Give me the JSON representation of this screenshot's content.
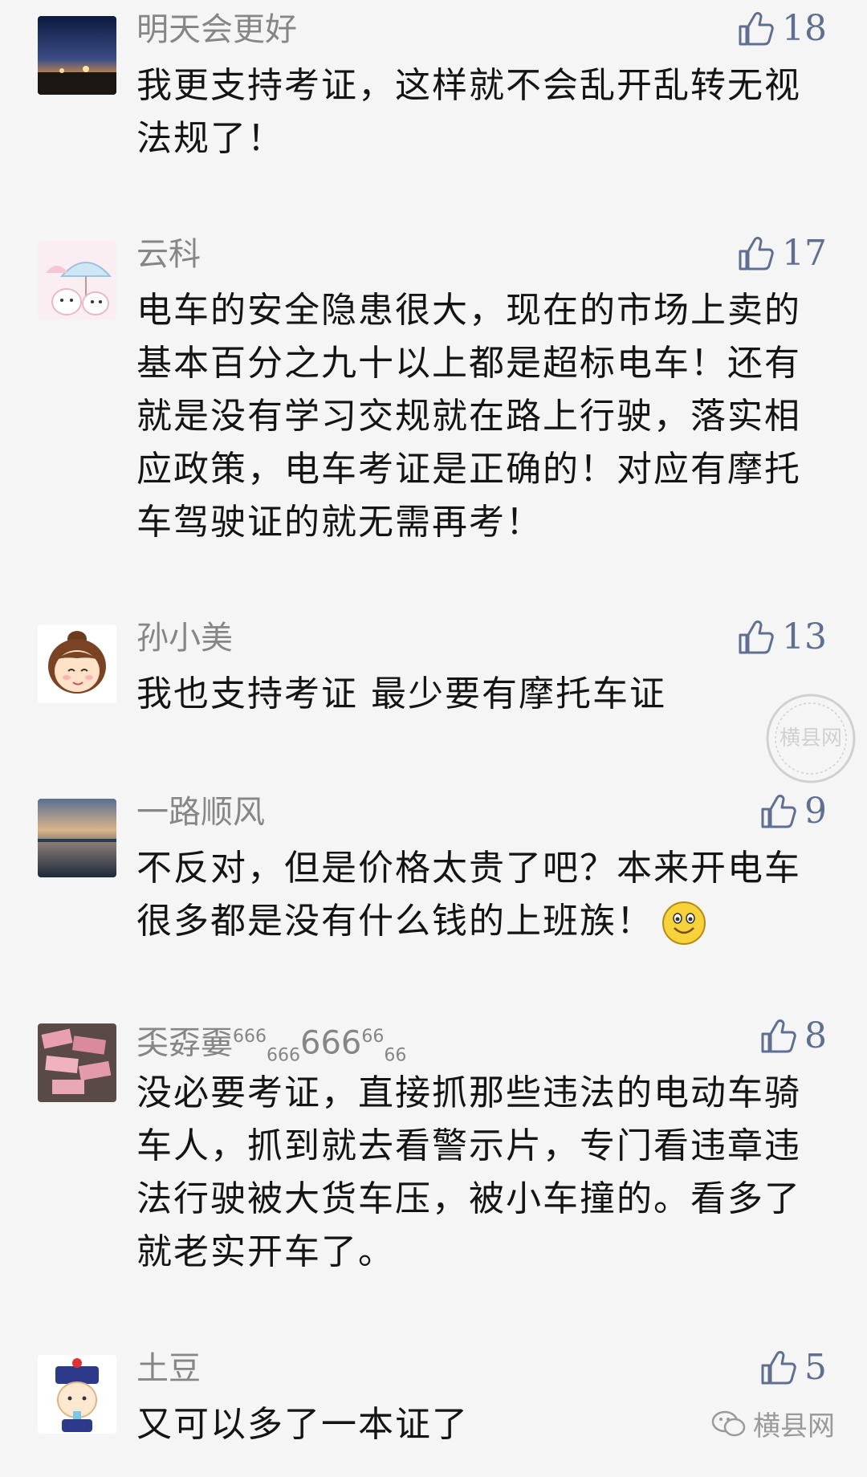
{
  "comments": [
    {
      "nickname": "明天会更好",
      "likes": "18",
      "avatar": "night-road-photo",
      "content": "我更支持考证，这样就不会乱开乱转无视法规了！"
    },
    {
      "nickname": "云科",
      "likes": "17",
      "avatar": "cartoon-umbrella",
      "content": "电车的安全隐患很大，现在的市场上卖的基本百分之九十以上都是超标电车！还有就是没有学习交规就在路上行驶，落实相应政策，电车考证是正确的！对应有摩托车驾驶证的就无需再考！"
    },
    {
      "nickname": "孙小美",
      "likes": "13",
      "avatar": "cartoon-girl",
      "content": "我也支持考证  最少要有摩托车证"
    },
    {
      "nickname": "一路顺风",
      "likes": "9",
      "avatar": "sunset-sea-photo",
      "content": "不反对，但是价格太贵了吧？本来开电车很多都是没有什么钱的上班族！"
    },
    {
      "nickname": "奀孬嫑",
      "nickname_parts": [
        "666",
        "666",
        "666",
        "66",
        "66"
      ],
      "likes": "8",
      "avatar": "banknotes-photo",
      "content": "没必要考证，直接抓那些违法的电动车骑车人，抓到就去看警示片，专门看违章违法行驶被大货车压，被小车撞的。看多了就老实开车了。"
    },
    {
      "nickname": "土豆",
      "likes": "5",
      "avatar": "cartoon-qing-official",
      "content": "又可以多了一本证了"
    }
  ],
  "watermark": {
    "seal_text": "横县网",
    "brand": "横县网"
  },
  "colors": {
    "background": "#f5f5f5",
    "nickname": "#868686",
    "like": "#5f6f92",
    "text": "#141414"
  }
}
